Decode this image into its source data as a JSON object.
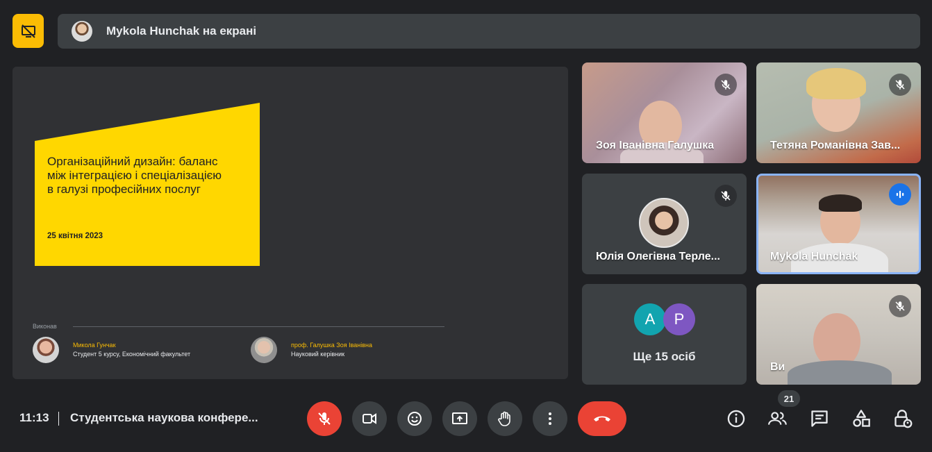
{
  "top": {
    "presenting_text": "Mykola Hunchak на екрані"
  },
  "slide": {
    "title": "Організаційний дизайн: баланс між інтеграцією і спеціалізацією в галузі професійних послуг",
    "date": "25 квітня 2023",
    "performed_by": "Виконав",
    "people": [
      {
        "name": "Микола Гунчак",
        "role": "Студент 5 курсу, Економічний факультет"
      },
      {
        "name": "проф. Галушка Зоя Іванівна",
        "role": "Науковий керівник"
      }
    ]
  },
  "tiles": [
    {
      "name": "Зоя Іванівна Галушка"
    },
    {
      "name": "Тетяна Романівна Зав..."
    },
    {
      "name": "Юлія Олегівна Терле..."
    },
    {
      "name": "Mykola Hunchak"
    },
    {
      "more_label": "Ще 15 осіб",
      "avatars": [
        "A",
        "P"
      ]
    },
    {
      "name": "Ви"
    }
  ],
  "bottom": {
    "clock": "11:13",
    "meeting_title": "Студентська наукова конфере...",
    "participants_count": "21"
  },
  "colors": {
    "accent_yellow": "#fbbc04",
    "slide_yellow": "#ffd700",
    "danger_red": "#ea4335",
    "active_blue": "#8ab4f8",
    "avatar_a": "#12a4af",
    "avatar_p": "#7e57c2"
  }
}
